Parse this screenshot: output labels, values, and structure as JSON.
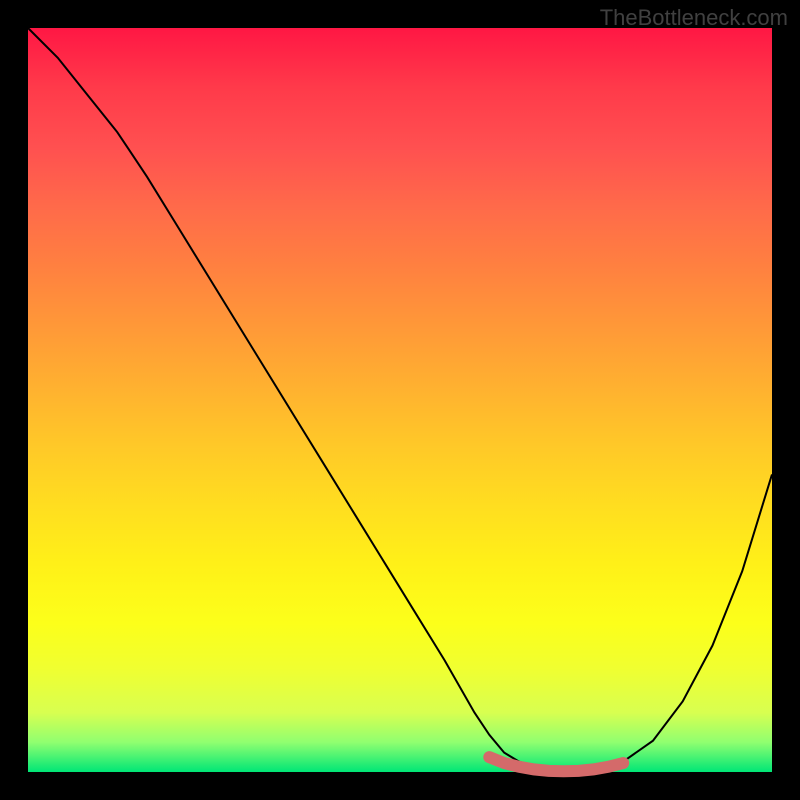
{
  "watermark": "TheBottleneck.com",
  "chart_data": {
    "type": "line",
    "title": "",
    "xlabel": "",
    "ylabel": "",
    "xlim": [
      0,
      100
    ],
    "ylim": [
      0,
      100
    ],
    "background_gradient": {
      "direction": "vertical",
      "stops": [
        {
          "pos": 0,
          "color": "#ff1744"
        },
        {
          "pos": 50,
          "color": "#ffc828"
        },
        {
          "pos": 80,
          "color": "#fcff1a"
        },
        {
          "pos": 100,
          "color": "#00e676"
        }
      ]
    },
    "series": [
      {
        "name": "bottleneck-curve",
        "stroke": "#000000",
        "x": [
          0,
          4,
          8,
          12,
          16,
          20,
          24,
          28,
          32,
          36,
          40,
          44,
          48,
          52,
          56,
          60,
          62,
          64,
          66,
          68,
          70,
          72,
          74,
          76,
          78,
          80,
          84,
          88,
          92,
          96,
          100
        ],
        "y": [
          100,
          96,
          91,
          86,
          80,
          73.5,
          67,
          60.5,
          54,
          47.5,
          41,
          34.5,
          28,
          21.5,
          15,
          8,
          5,
          2.6,
          1.4,
          0.7,
          0.3,
          0.1,
          0.1,
          0.3,
          0.7,
          1.4,
          4.2,
          9.5,
          17,
          27,
          40
        ]
      },
      {
        "name": "optimal-range",
        "stroke": "#d46a6a",
        "x": [
          62,
          64,
          66,
          68,
          70,
          72,
          74,
          76,
          78,
          80
        ],
        "y": [
          2.0,
          1.2,
          0.7,
          0.35,
          0.15,
          0.1,
          0.15,
          0.35,
          0.7,
          1.2
        ]
      }
    ],
    "annotations": []
  }
}
